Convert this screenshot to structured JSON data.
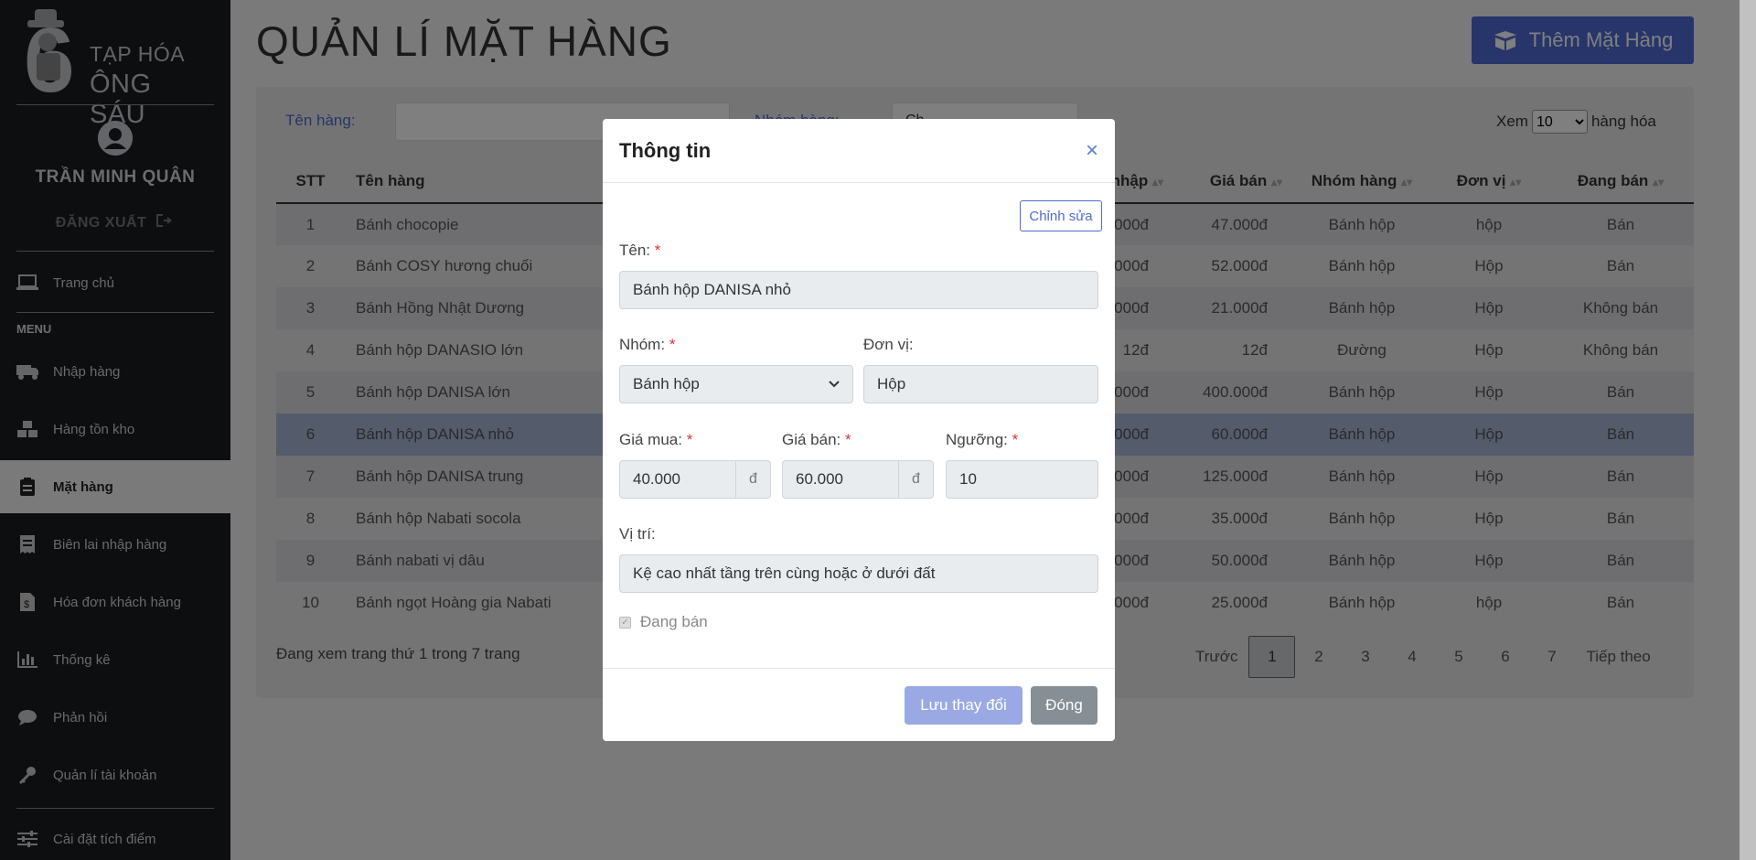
{
  "sidebar": {
    "logo_line1": "TẠP HÓA",
    "logo_line2": "ÔNG SÁU",
    "user_name": "TRẦN MINH QUÂN",
    "logout": "ĐĂNG XUẤT",
    "menu_header": "MENU",
    "home": "Trang chủ",
    "items": [
      {
        "label": "Nhập hàng",
        "icon": "truck-icon"
      },
      {
        "label": "Hàng tồn kho",
        "icon": "boxes-icon"
      },
      {
        "label": "Mặt hàng",
        "icon": "clipboard-icon"
      },
      {
        "label": "Biên lai nhập hàng",
        "icon": "receipt-icon"
      },
      {
        "label": "Hóa đơn khách hàng",
        "icon": "invoice-icon"
      },
      {
        "label": "Thống kê",
        "icon": "chart-icon"
      },
      {
        "label": "Phản hồi",
        "icon": "comment-icon"
      },
      {
        "label": "Quản lí tài khoản",
        "icon": "key-icon"
      },
      {
        "label": "Cài đặt tích điểm",
        "icon": "sliders-icon"
      }
    ]
  },
  "page": {
    "title": "QUẢN LÍ MẶT HÀNG",
    "add_button": "Thêm Mặt Hàng"
  },
  "filter": {
    "name_label": "Tên hàng:",
    "name_value": "",
    "group_label": "Nhóm hàng:",
    "group_value": "Ch",
    "show_prefix": "Xem",
    "show_value": "10",
    "show_suffix": "hàng hóa"
  },
  "table": {
    "columns": [
      "STT",
      "Tên hàng",
      "Giá nhập",
      "Giá bán",
      "Nhóm hàng",
      "Đơn vị",
      "Đang bán"
    ],
    "rows": [
      [
        "1",
        "Bánh chocopie",
        "000đ",
        "47.000đ",
        "Bánh hộp",
        "hộp",
        "Bán"
      ],
      [
        "2",
        "Bánh COSY hương chuối",
        "000đ",
        "52.000đ",
        "Bánh hộp",
        "Hộp",
        "Bán"
      ],
      [
        "3",
        "Bánh Hồng Nhật Dương",
        "000đ",
        "21.000đ",
        "Bánh hộp",
        "Hộp",
        "Không bán"
      ],
      [
        "4",
        "Bánh hộp DANASIO lớn",
        "12đ",
        "12đ",
        "Đường",
        "Hộp",
        "Không bán"
      ],
      [
        "5",
        "Bánh hộp DANISA lớn",
        "000đ",
        "400.000đ",
        "Bánh hộp",
        "Hộp",
        "Bán"
      ],
      [
        "6",
        "Bánh hộp DANISA nhỏ",
        "000đ",
        "60.000đ",
        "Bánh hộp",
        "Hộp",
        "Bán"
      ],
      [
        "7",
        "Bánh hộp DANISA trung",
        "000đ",
        "125.000đ",
        "Bánh hộp",
        "Hộp",
        "Bán"
      ],
      [
        "8",
        "Bánh hộp Nabati socola",
        "000đ",
        "35.000đ",
        "Bánh hộp",
        "Hộp",
        "Bán"
      ],
      [
        "9",
        "Bánh nabati vị dâu",
        "000đ",
        "50.000đ",
        "Bánh hộp",
        "Hộp",
        "Bán"
      ],
      [
        "10",
        "Bánh ngọt Hoàng gia Nabati",
        "000đ",
        "25.000đ",
        "Bánh hộp",
        "hộp",
        "Bán"
      ]
    ],
    "selected_row": 6,
    "info": "Đang xem trang thứ 1 trong 7 trang"
  },
  "pager": {
    "prev": "Trước",
    "pages": [
      "1",
      "2",
      "3",
      "4",
      "5",
      "6",
      "7"
    ],
    "current": "1",
    "next": "Tiếp theo"
  },
  "modal": {
    "title": "Thông tin",
    "close": "×",
    "edit_button": "Chỉnh sửa",
    "name_label": "Tên:",
    "name_value": "Bánh hộp DANISA nhỏ",
    "group_label": "Nhóm:",
    "group_value": "Bánh hộp",
    "unit_label": "Đơn vị:",
    "unit_value": "Hộp",
    "buy_label": "Giá mua:",
    "buy_value": "40.000",
    "sell_label": "Giá bán:",
    "sell_value": "60.000",
    "currency": "đ",
    "threshold_label": "Ngưỡng:",
    "threshold_value": "10",
    "location_label": "Vị trí:",
    "location_value": "Kệ cao nhất tầng trên cùng hoặc ở dưới đất",
    "selling_label": "Đang bán",
    "selling_checked": true,
    "required_mark": "*",
    "save_button": "Lưu thay đổi",
    "close_button": "Đóng"
  },
  "colors": {
    "primary": "#4e6bd4",
    "sidebar_bg": "#1a1d21",
    "selected_row": "#a9b7d6",
    "required": "#e03131"
  }
}
